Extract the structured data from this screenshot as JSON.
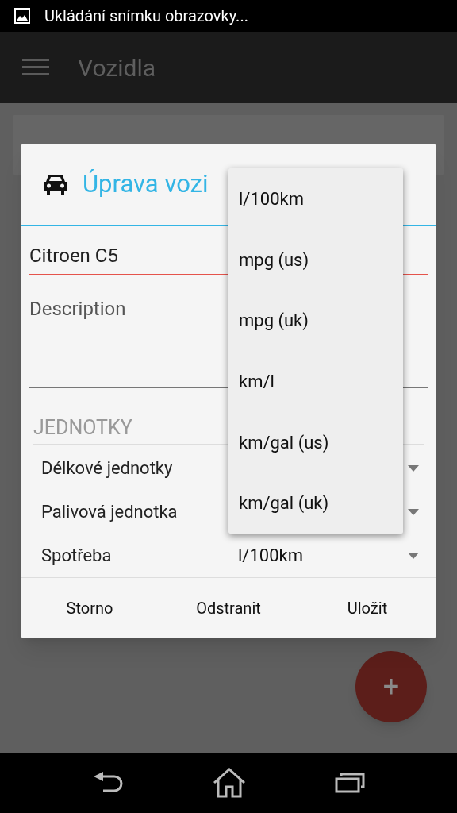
{
  "status_bar": {
    "notification": "Ukládání snímku obrazovky..."
  },
  "app_bar": {
    "title": "Vozidla"
  },
  "dialog": {
    "title": "Úprava vozi",
    "name_field": {
      "value": "Citroen C5"
    },
    "description_field": {
      "placeholder": "Description"
    },
    "section_header": "JEDNOTKY",
    "settings": [
      {
        "label": "Délkové jednotky"
      },
      {
        "label": "Palivová jednotka"
      },
      {
        "label": "Spotřeba",
        "value": "l/100km"
      }
    ],
    "buttons": [
      "Storno",
      "Odstranit",
      "Uložit"
    ]
  },
  "dropdown": {
    "options": [
      "l/100km",
      "mpg (us)",
      "mpg (uk)",
      "km/l",
      "km/gal (us)",
      "km/gal (uk)"
    ]
  },
  "fab": {
    "label": "+"
  }
}
